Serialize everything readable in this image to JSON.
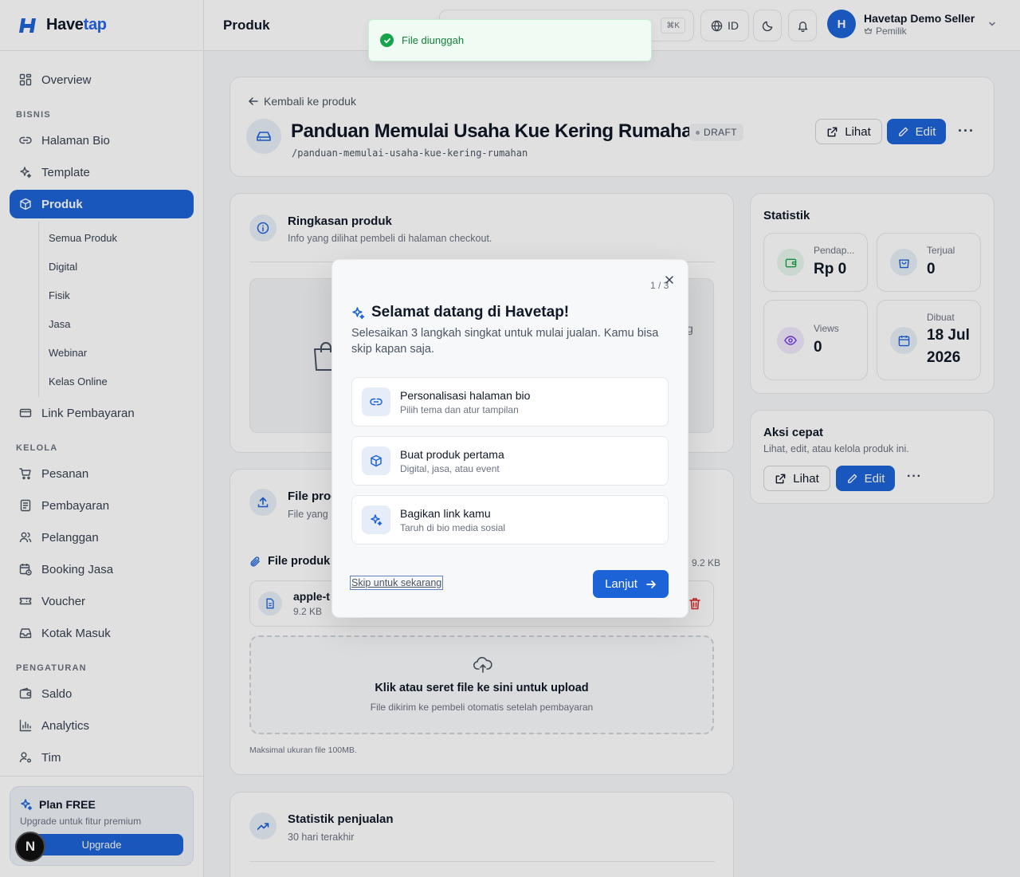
{
  "brand": {
    "name_main": "Have",
    "name_accent": "tap"
  },
  "sidebar": {
    "overview": "Overview",
    "section_bisnis": "BISNIS",
    "bisnis_items": [
      "Halaman Bio",
      "Template",
      "Produk"
    ],
    "produk_sub": [
      "Semua Produk",
      "Digital",
      "Fisik",
      "Jasa",
      "Webinar",
      "Kelas Online"
    ],
    "link_pembayaran": "Link Pembayaran",
    "section_kelola": "KELOLA",
    "kelola_items": [
      "Pesanan",
      "Pembayaran",
      "Pelanggan",
      "Booking Jasa",
      "Voucher",
      "Kotak Masuk"
    ],
    "section_pengaturan": "PENGATURAN",
    "pengaturan_items": [
      "Saldo",
      "Analytics",
      "Tim"
    ],
    "plan": {
      "title": "Plan FREE",
      "subtitle": "Upgrade untuk fitur premium",
      "button": "Upgrade"
    },
    "badge_letter": "N"
  },
  "topbar": {
    "page": "Produk",
    "kbd": "⌘K",
    "lang": "ID",
    "user_initial": "H",
    "user_name": "Havetap Demo Seller",
    "user_role": "Pemilik"
  },
  "header_card": {
    "back": "Kembali ke produk",
    "title": "Panduan Memulai Usaha Kue Kering Rumahan",
    "status": "DRAFT",
    "slug": "/panduan-memulai-usaha-kue-kering-rumahan",
    "view_label": "Lihat",
    "edit_label": "Edit",
    "more": "···"
  },
  "summary_card": {
    "title": "Ringkasan produk",
    "subtitle": "Info yang dilihat pembeli di halaman checkout.",
    "partial_text": "g"
  },
  "file_card": {
    "title": "File prod",
    "subtitle": "File yang",
    "list_label": "File produk",
    "total_size": "9.2 KB",
    "file_name": "apple-t",
    "file_size": "9.2 KB",
    "drop_title": "Klik atau seret file ke sini untuk upload",
    "drop_sub": "File dikirim ke pembeli otomatis setelah pembayaran",
    "max_note": "Maksimal ukuran file 100MB."
  },
  "sales_card": {
    "title": "Statistik penjualan",
    "subtitle": "30 hari terakhir"
  },
  "stats_card": {
    "title": "Statistik",
    "tiles": [
      {
        "label": "Pendap...",
        "value": "Rp 0"
      },
      {
        "label": "Terjual",
        "value": "0"
      },
      {
        "label": "Views",
        "value": "0"
      },
      {
        "label": "Dibuat",
        "value_line1": "18 Jul",
        "value_line2": "2026"
      }
    ],
    "colors": {
      "green": "#16a34a",
      "blue": "#1d63d8",
      "purple": "#7c3aed"
    }
  },
  "quick_card": {
    "title": "Aksi cepat",
    "subtitle": "Lihat, edit, atau kelola produk ini.",
    "view_label": "Lihat",
    "edit_label": "Edit",
    "more": "···"
  },
  "toast": {
    "message": "File diunggah"
  },
  "modal": {
    "step_count": "1 / 3",
    "title": "Selamat datang di Havetap!",
    "description": "Selesaikan 3 langkah singkat untuk mulai jualan. Kamu bisa skip kapan saja.",
    "steps": [
      {
        "title": "Personalisasi halaman bio",
        "subtitle": "Pilih tema dan atur tampilan"
      },
      {
        "title": "Buat produk pertama",
        "subtitle": "Digital, jasa, atau event"
      },
      {
        "title": "Bagikan link kamu",
        "subtitle": "Taruh di bio media sosial"
      }
    ],
    "skip": "Skip untuk sekarang",
    "next": "Lanjut"
  },
  "accent_color": "#1d63d8"
}
